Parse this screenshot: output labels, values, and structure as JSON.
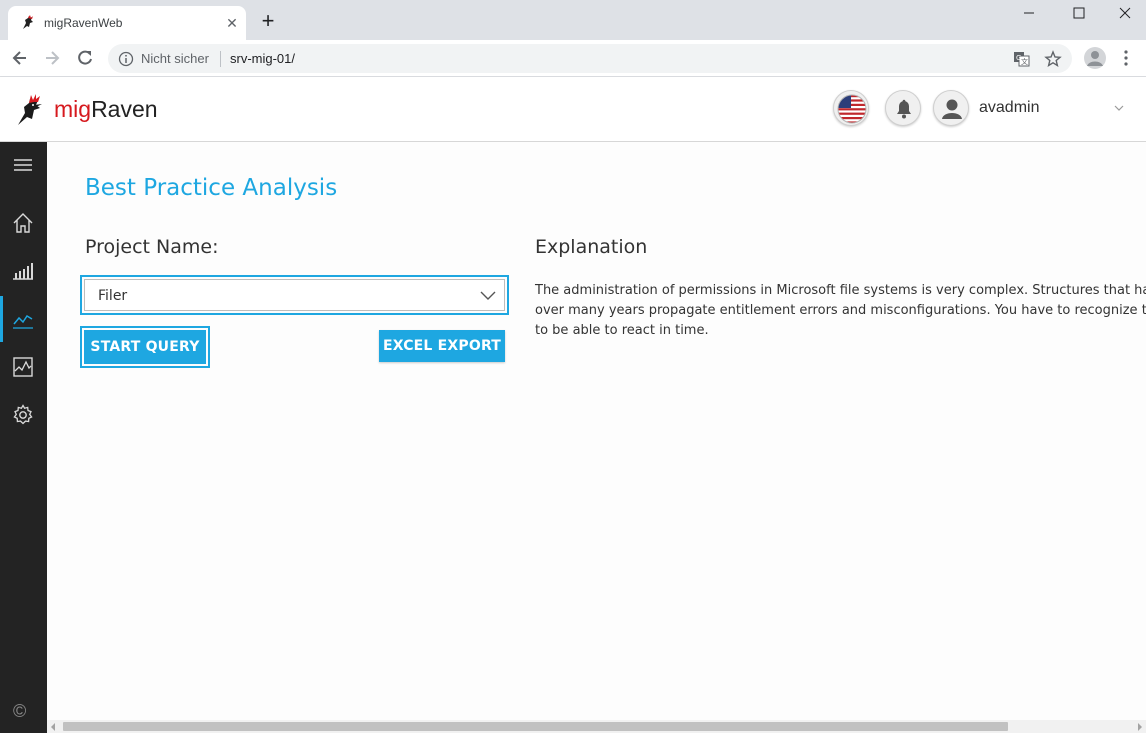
{
  "browser": {
    "tab_title": "migRavenWeb",
    "tab_close": "✕",
    "new_tab": "+",
    "address": {
      "security_label": "Nicht sicher",
      "url": "srv-mig-01/"
    }
  },
  "app": {
    "brand_part1": "mig",
    "brand_part2": "Raven",
    "brand_color": "#d6191e",
    "accent_color": "#1ea7e1",
    "user": {
      "name": "avadmin"
    },
    "language_flag": "us-flag-icon"
  },
  "sidebar": {
    "items": [
      {
        "icon": "menu-icon"
      },
      {
        "icon": "home-icon"
      },
      {
        "icon": "bar-chart-icon"
      },
      {
        "icon": "line-chart-icon",
        "active": true
      },
      {
        "icon": "activity-chart-icon"
      },
      {
        "icon": "gear-icon"
      }
    ],
    "footer": "©"
  },
  "main": {
    "page_title": "Best Practice Analysis",
    "project_label": "Project Name:",
    "project_select": {
      "selected": "Filer"
    },
    "buttons": {
      "start_query": "START QUERY",
      "excel_export": "EXCEL EXPORT"
    },
    "explanation": {
      "title": "Explanation",
      "text": "The administration of permissions in Microsoft file systems is very complex. Structures that have grown over many years propagate entitlement errors and misconfigurations. You have to recognize these in order to be able to react in time."
    }
  }
}
